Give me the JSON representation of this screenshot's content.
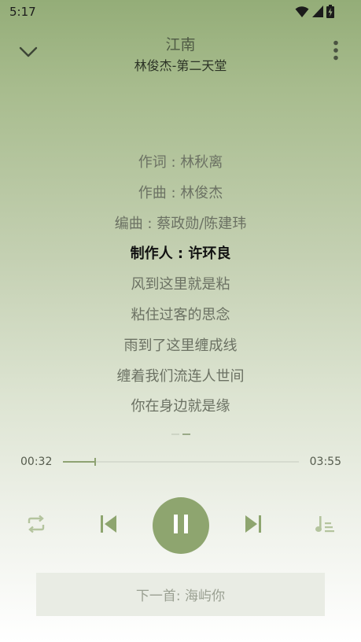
{
  "status_bar": {
    "time": "5:17",
    "icons": [
      "wifi-icon",
      "cell-signal-icon",
      "battery-icon"
    ]
  },
  "header": {
    "title": "江南",
    "subtitle": "林俊杰-第二天堂",
    "collapse_icon": "chevron-down-icon",
    "more_icon": "more-vertical-icon"
  },
  "lyrics": {
    "lines": [
      "作词 : 林秋离",
      "作曲 : 林俊杰",
      "编曲 : 蔡政勋/陈建玮",
      "制作人 : 许环良",
      "风到这里就是粘",
      "粘住过客的思念",
      "雨到了这里缠成线",
      "缠着我们流连人世间",
      "你在身边就是缘"
    ],
    "active_index": 3
  },
  "progress": {
    "current": "00:32",
    "total": "03:55",
    "fraction": 0.136
  },
  "controls": {
    "repeat_icon": "repeat-icon",
    "prev_icon": "skip-previous-icon",
    "play_icon": "pause-icon",
    "next_icon": "skip-next-icon",
    "playlist_icon": "playlist-icon"
  },
  "next_up": {
    "label": "下一首: 海屿你"
  },
  "colors": {
    "accent": "#8ea56f",
    "lyric_active": "#111111",
    "lyric_inactive": "#6b7163"
  }
}
